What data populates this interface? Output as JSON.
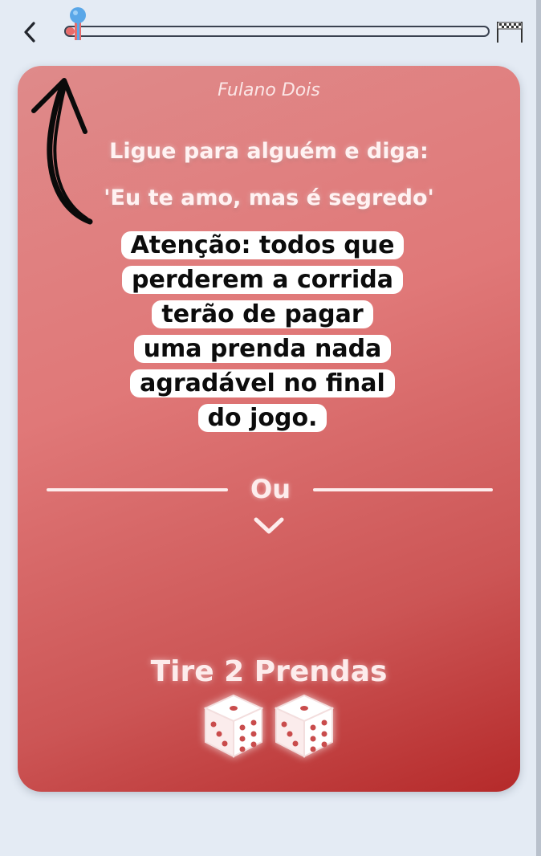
{
  "header": {
    "back_icon": "chevron-left-icon",
    "progress_percent": 2,
    "finish_icon": "finish-flag-icon",
    "accent_color": "#5aa7e8"
  },
  "card": {
    "player_name": "Fulano Dois",
    "challenge_lines": [
      "Ligue para alguém e diga:",
      "'Eu te amo, mas é segredo'"
    ],
    "or_label": "Ou",
    "alt_title": "Tire 2 Prendas",
    "dice_icon": "dice-icon",
    "gradient_colors": [
      "#df8a8a",
      "#b52a2a"
    ]
  },
  "overlay": {
    "notice_lines": [
      "Atenção: todos que",
      "perderem a corrida",
      "terão de pagar",
      "uma prenda nada",
      "agradável no final",
      "do jogo."
    ]
  }
}
